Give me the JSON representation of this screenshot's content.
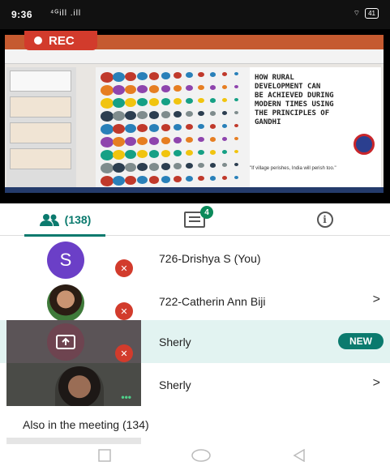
{
  "status_bar": {
    "time": "9:36",
    "network": "⁴ᴳill .ill",
    "battery": "41"
  },
  "recording": {
    "label": "REC"
  },
  "slide": {
    "title": "HOW RURAL\nDEVELOPMENT CAN\nBE ACHIEVED DURING\nMODERN TIMES USING\nTHE PRINCIPLES OF\nGANDHI",
    "quote": "\"If village perishes, India will perish too.\""
  },
  "tabs": {
    "people_count": "(138)",
    "chat_badge": "4",
    "info_glyph": "i"
  },
  "participants": [
    {
      "name": "726-Drishya S (You)",
      "initial": "S",
      "avatar_color": "#6b3fc7",
      "muted": true,
      "chevron": ""
    },
    {
      "name": "722-Catherin Ann Biji",
      "muted": true,
      "chevron": ">"
    },
    {
      "name": "Sherly",
      "presenting": true,
      "badge": "NEW"
    },
    {
      "name": "Sherly",
      "chevron": ">",
      "more": "•••"
    }
  ],
  "also_in_meeting": "Also in the meeting (134)",
  "colors": {
    "accent": "#0b7a6e",
    "rec": "#d23b2c",
    "highlight_row": "#e2f3f1"
  }
}
